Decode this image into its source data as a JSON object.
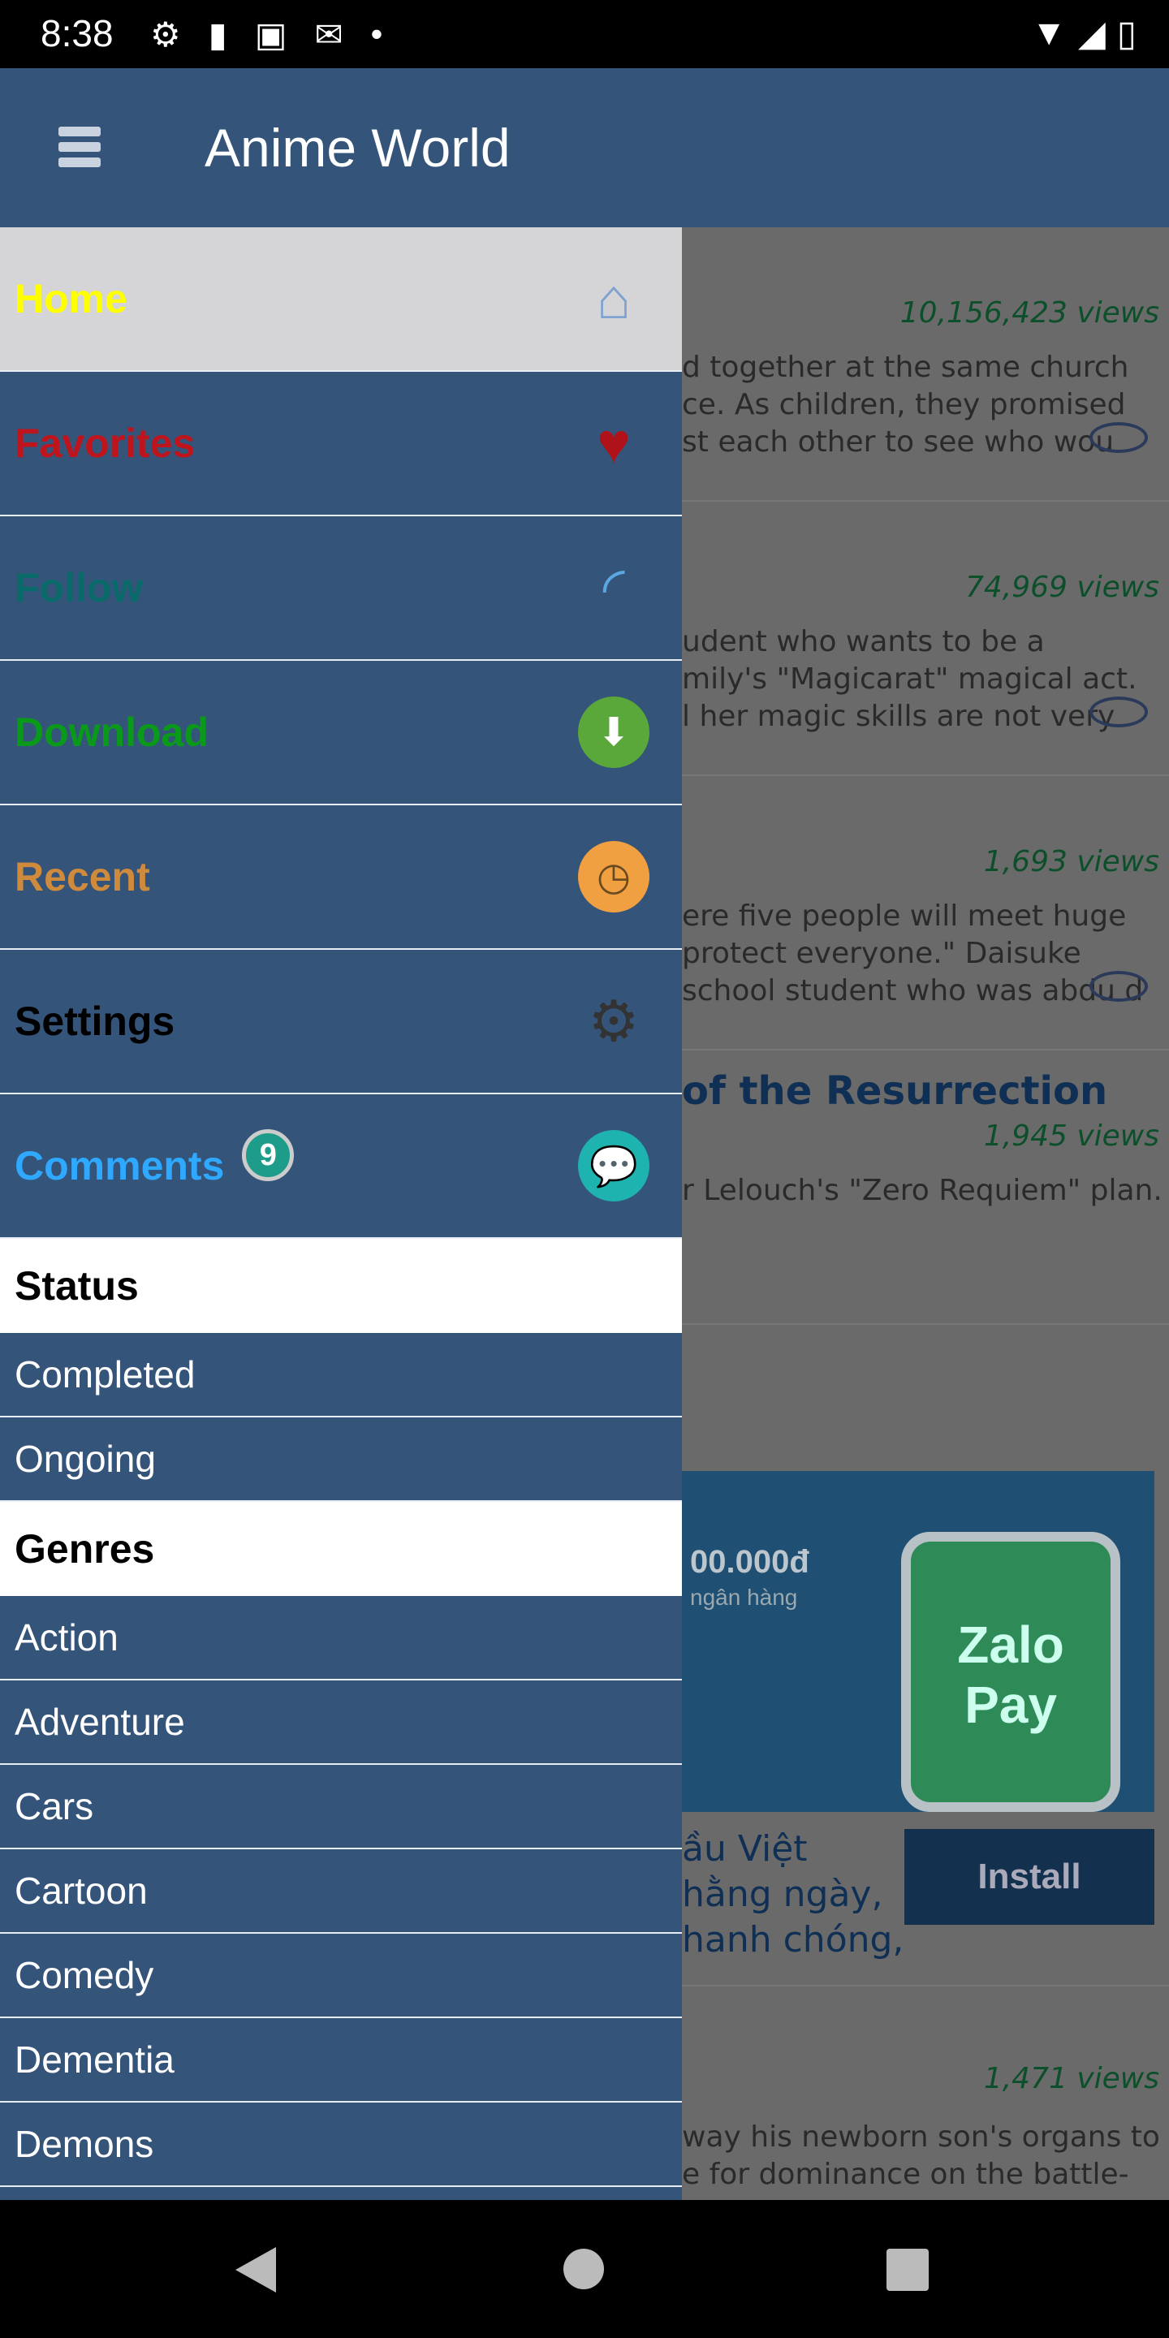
{
  "status_bar": {
    "time": "8:38"
  },
  "app_bar": {
    "title": "Anime World"
  },
  "drawer": {
    "menu": [
      {
        "label": "Home",
        "color": "#ffff00",
        "icon": "home-icon"
      },
      {
        "label": "Favorites",
        "color": "#c0141c",
        "icon": "heart-icon"
      },
      {
        "label": "Follow",
        "color": "#0a6a6a",
        "icon": "rss-icon"
      },
      {
        "label": "Download",
        "color": "#0a9a1a",
        "icon": "download-icon"
      },
      {
        "label": "Recent",
        "color": "#d08a3c",
        "icon": "clock-icon"
      },
      {
        "label": "Settings",
        "color": "#000000",
        "icon": "gear-icon"
      },
      {
        "label": "Comments",
        "color": "#2fa8ff",
        "icon": "chat-icon",
        "badge": "9"
      }
    ],
    "status_header": "Status",
    "status_items": [
      "Completed",
      "Ongoing"
    ],
    "genres_header": "Genres",
    "genre_items": [
      "Action",
      "Adventure",
      "Cars",
      "Cartoon",
      "Comedy",
      "Dementia",
      "Demons"
    ]
  },
  "content": {
    "cards": [
      {
        "views": "10,156,423 views",
        "lines": [
          "d together at the same church",
          "ce. As children, they promised",
          "st each other to see who wou"
        ]
      },
      {
        "views": "74,969 views",
        "lines": [
          "udent who wants to be a",
          "mily's \"Magicarat\" magical act.",
          "l her magic skills are not very"
        ]
      },
      {
        "views": "1,693 views",
        "lines": [
          "ere five people will meet huge",
          "protect everyone.\" Daisuke",
          "school student who was abdu    d"
        ]
      },
      {
        "title": "of the Resurrection",
        "views": "1,945 views",
        "lines": [
          "r Lelouch's \"Zero Requiem\" plan."
        ]
      }
    ],
    "ad": {
      "amount": "00.000đ",
      "sub": "ngân hàng",
      "brand": "Zalo Pay",
      "lines": [
        "ầu Việt",
        "hằng ngày,",
        "hanh chóng,"
      ],
      "install": "Install"
    },
    "last_card": {
      "views": "1,471 views",
      "lines": [
        "way his newborn son's organs to",
        "e for dominance on the battle-"
      ]
    }
  }
}
